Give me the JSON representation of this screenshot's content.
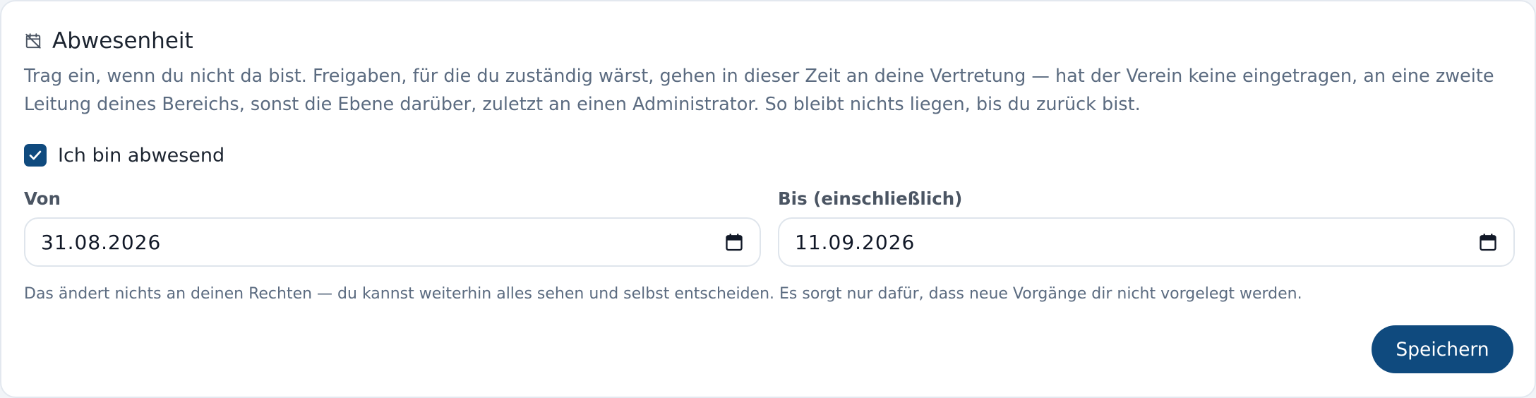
{
  "section": {
    "title": "Abwesenheit",
    "icon": "calendar-off-icon",
    "description": "Trag ein, wenn du nicht da bist. Freigaben, für die du zuständig wärst, gehen in dieser Zeit an deine Vertretung — hat der Verein keine eingetragen, an eine zweite Leitung deines Bereichs, sonst die Ebene darüber, zuletzt an einen Administrator. So bleibt nichts liegen, bis du zurück bist."
  },
  "absent_checkbox": {
    "label": "Ich bin abwesend",
    "checked": true
  },
  "from_field": {
    "label": "Von",
    "value": "31.08.2026",
    "icon": "calendar-icon"
  },
  "to_field": {
    "label": "Bis (einschließlich)",
    "value": "11.09.2026",
    "icon": "calendar-icon"
  },
  "hint": "Das ändert nichts an deinen Rechten — du kannst weiterhin alles sehen und selbst entscheiden. Es sorgt nur dafür, dass neue Vorgänge dir nicht vorgelegt werden.",
  "save_button": {
    "label": "Speichern"
  },
  "colors": {
    "accent": "#0f4a7e",
    "text": "#1c2430",
    "muted": "#5b6b80",
    "border": "#dfe5ec"
  }
}
